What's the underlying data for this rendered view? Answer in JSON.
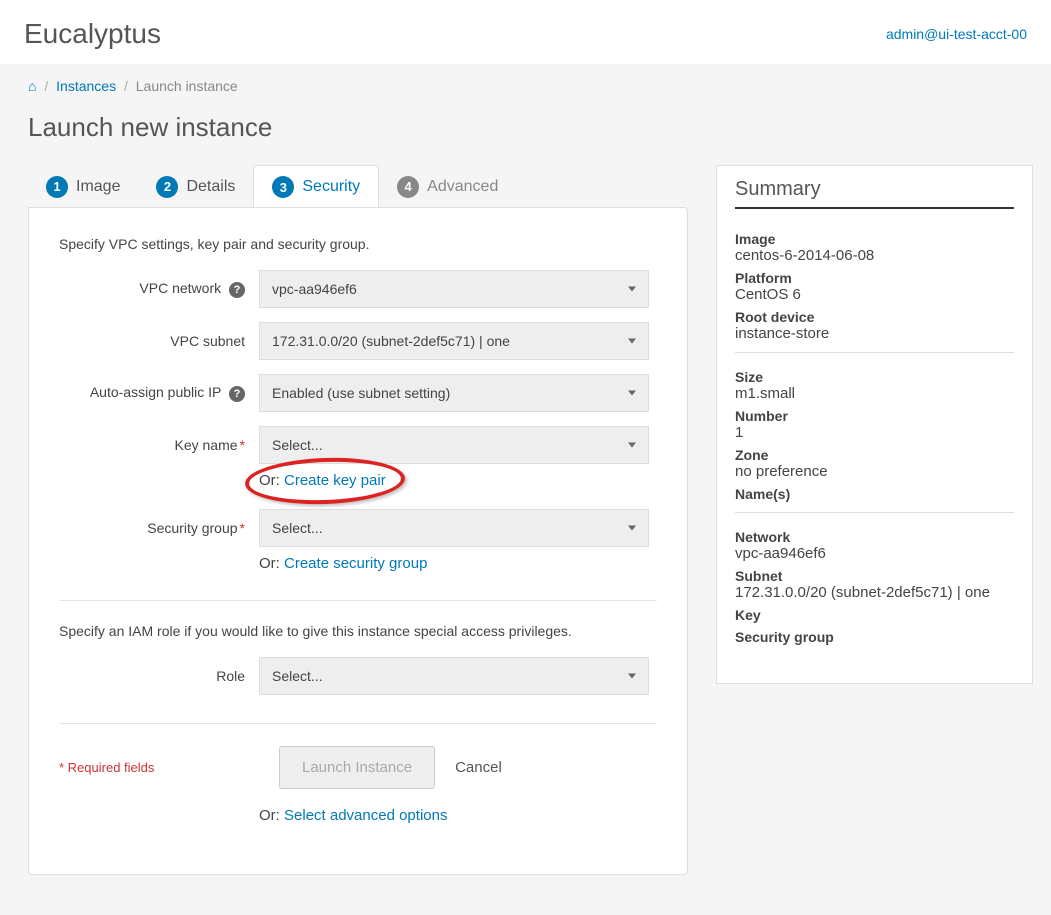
{
  "header": {
    "brand": "Eucalyptus",
    "user": "admin@ui-test-acct-00"
  },
  "breadcrumb": {
    "instances": "Instances",
    "current": "Launch instance"
  },
  "page_title": "Launch new instance",
  "tabs": {
    "t1": {
      "num": "1",
      "label": "Image"
    },
    "t2": {
      "num": "2",
      "label": "Details"
    },
    "t3": {
      "num": "3",
      "label": "Security"
    },
    "t4": {
      "num": "4",
      "label": "Advanced"
    }
  },
  "form": {
    "intro": "Specify VPC settings, key pair and security group.",
    "vpc_label": "VPC network",
    "vpc_value": "vpc-aa946ef6",
    "subnet_label": "VPC subnet",
    "subnet_value": "172.31.0.0/20 (subnet-2def5c71) | one",
    "autoip_label": "Auto-assign public IP",
    "autoip_value": "Enabled (use subnet setting)",
    "key_label": "Key name",
    "key_value": "Select...",
    "key_or": "Or:",
    "key_create": "Create key pair",
    "sg_label": "Security group",
    "sg_value": "Select...",
    "sg_or": "Or:",
    "sg_create": "Create security group",
    "iam_intro": "Specify an IAM role if you would like to give this instance special access privileges.",
    "role_label": "Role",
    "role_value": "Select...",
    "required_note": "* Required fields",
    "launch_btn": "Launch Instance",
    "cancel_btn": "Cancel",
    "adv_or": "Or:",
    "adv_link": "Select advanced options"
  },
  "summary": {
    "title": "Summary",
    "image_l": "Image",
    "image_v": "centos-6-2014-06-08",
    "platform_l": "Platform",
    "platform_v": "CentOS 6",
    "rootdev_l": "Root device",
    "rootdev_v": "instance-store",
    "size_l": "Size",
    "size_v": "m1.small",
    "number_l": "Number",
    "number_v": "1",
    "zone_l": "Zone",
    "zone_v": "no preference",
    "names_l": "Name(s)",
    "network_l": "Network",
    "network_v": "vpc-aa946ef6",
    "subnet_l": "Subnet",
    "subnet_v": "172.31.0.0/20 (subnet-2def5c71) | one",
    "key_l": "Key",
    "sg_l": "Security group"
  }
}
